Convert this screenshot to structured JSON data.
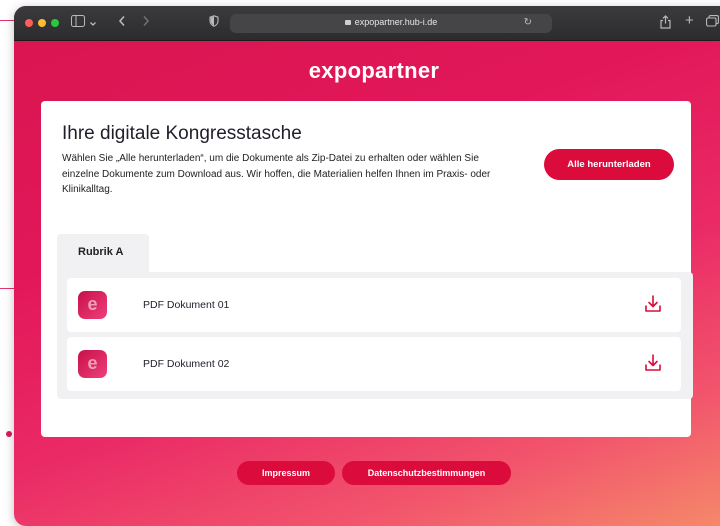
{
  "browser": {
    "url": "expopartner.hub-i.de"
  },
  "brand": {
    "name": "expopartner"
  },
  "main": {
    "title": "Ihre digitale Kongresstasche",
    "description": "Wählen Sie „Alle herunterladen“, um die Dokumente als Zip-Datei zu erhalten oder wählen Sie einzelne Dokumente zum Download aus. Wir hoffen, die Materialien helfen Ihnen im Praxis- oder Klinikalltag.",
    "download_all_label": "Alle herunterladen",
    "tabs": [
      {
        "label": "Rubrik A"
      }
    ],
    "documents": [
      {
        "name": "PDF Dokument 01",
        "icon": "download-icon"
      },
      {
        "name": "PDF Dokument 02",
        "icon": "download-icon"
      }
    ]
  },
  "footer": {
    "links": [
      {
        "label": "Impressum"
      },
      {
        "label": "Datenschutzbestimmungen"
      }
    ]
  },
  "colors": {
    "accent": "#db0b3b",
    "gradient_start": "#d8154f",
    "gradient_end": "#f58a6a"
  }
}
